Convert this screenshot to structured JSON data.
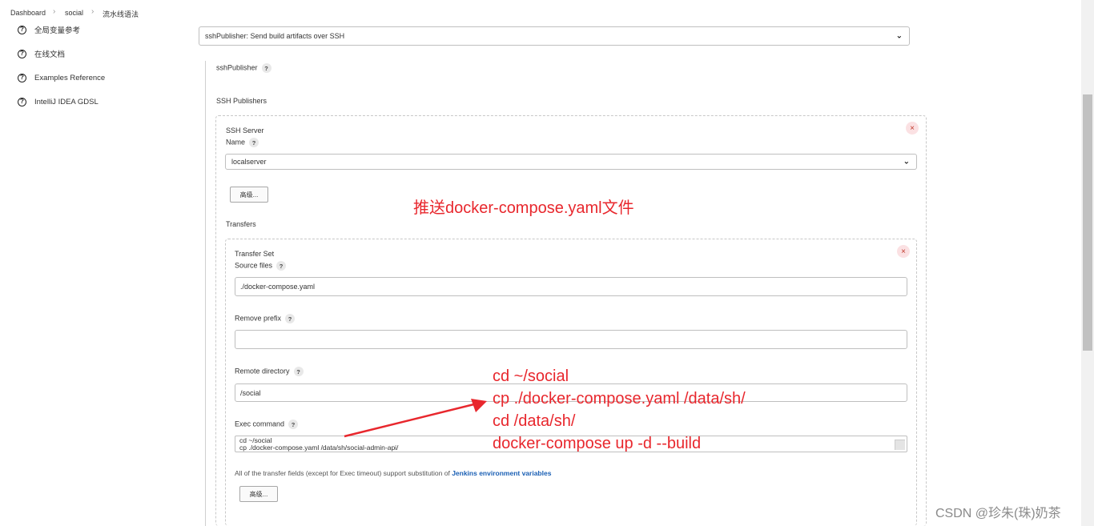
{
  "breadcrumb": [
    "Dashboard",
    "social",
    "流水线语法"
  ],
  "sidebar": {
    "items": [
      {
        "label": "全局变量参考"
      },
      {
        "label": "在线文档"
      },
      {
        "label": "Examples Reference"
      },
      {
        "label": "IntelliJ IDEA GDSL"
      }
    ]
  },
  "step_select": {
    "value": "sshPublisher: Send build artifacts over SSH"
  },
  "section": {
    "sshPublisher_label": "sshPublisher",
    "ssh_publishers_label": "SSH Publishers"
  },
  "ssh_server": {
    "heading": "SSH Server",
    "name_label": "Name",
    "name_value": "localserver",
    "advanced_button": "高级...",
    "transfers_label": "Transfers"
  },
  "transfer_set": {
    "heading": "Transfer Set",
    "source_files_label": "Source files",
    "source_files_value": "./docker-compose.yaml",
    "remove_prefix_label": "Remove prefix",
    "remove_prefix_value": "",
    "remote_directory_label": "Remote directory",
    "remote_directory_value": "/social",
    "exec_command_label": "Exec command",
    "exec_command_lines": [
      "cd ~/social",
      "cp ./docker-compose.yaml /data/sh/social-admin-api/"
    ],
    "note_text": "All of the transfer fields (except for Exec timeout) support substitution of ",
    "note_link": "Jenkins environment variables",
    "advanced_button": "高级..."
  },
  "help_glyph": "?",
  "close_glyph": "×",
  "annotations": {
    "push_caption": "推送docker-compose.yaml文件",
    "commands": [
      "cd ~/social",
      "cp ./docker-compose.yaml /data/sh/",
      "cd /data/sh/",
      "docker-compose up -d --build"
    ],
    "color": "#e8272d"
  },
  "watermark": "CSDN @珍朱(珠)奶茶"
}
